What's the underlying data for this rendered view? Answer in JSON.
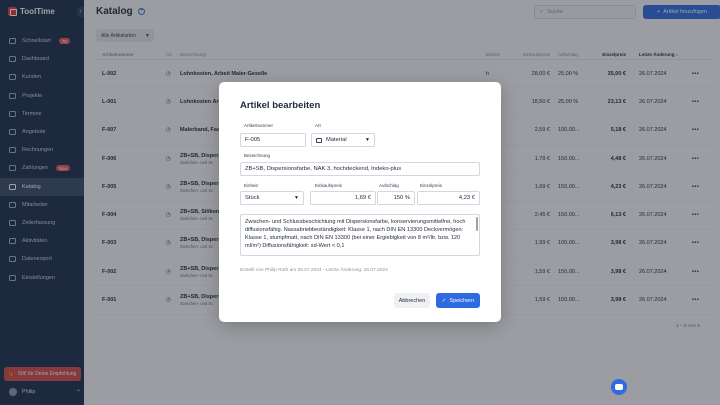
{
  "app": {
    "name": "ToolTime"
  },
  "sidebar": {
    "items": [
      {
        "label": "Schnellstart",
        "badge": "79",
        "icon": "rocket-icon"
      },
      {
        "label": "Dashboard",
        "icon": "dashboard-icon"
      },
      {
        "label": "Kunden",
        "icon": "users-icon"
      },
      {
        "label": "Projekte",
        "icon": "folder-icon"
      },
      {
        "label": "Termine",
        "icon": "calendar-icon"
      },
      {
        "label": "Angebote",
        "icon": "document-icon"
      },
      {
        "label": "Rechnungen",
        "icon": "invoice-icon"
      },
      {
        "label": "Zahlungen",
        "badge": "Neu",
        "icon": "payment-icon"
      },
      {
        "label": "Katalog",
        "active": true,
        "icon": "catalog-icon"
      },
      {
        "label": "Mitarbeiter",
        "icon": "team-icon"
      },
      {
        "label": "Zeiterfassung",
        "icon": "clock-icon"
      },
      {
        "label": "Aktivitäten",
        "icon": "activity-icon"
      },
      {
        "label": "Datenexport",
        "icon": "export-icon"
      },
      {
        "label": "Einstellungen",
        "icon": "gear-icon"
      }
    ],
    "promo": "50€ für Deine Empfehlung",
    "user": "Philip"
  },
  "main": {
    "title": "Katalog",
    "search_placeholder": "Suche",
    "add_button": "Artikel hinzufügen",
    "filter": "Alle Artikelarten",
    "columns": {
      "num": "Artikelnummer",
      "art": "Art",
      "desc": "Bezeichnung",
      "unit": "Einheit",
      "ek": "Einkaufspreis",
      "auf": "Aufschlag",
      "ep": "Einzelpreis",
      "date": "Letzte Änderung ↓"
    },
    "rows": [
      {
        "num": "L-002",
        "title": "Lohnkosten, Arbeit Maler-Geselle",
        "sub": "",
        "unit": "h",
        "ek": "28,00 €",
        "auf": "25,00 %",
        "ep": "35,00 €",
        "date": "26.07.2024"
      },
      {
        "num": "L-001",
        "title": "Lohnkosten Arb",
        "sub": "",
        "unit": "",
        "ek": "18,50 €",
        "auf": "25,00 %",
        "ep": "23,13 €",
        "date": "26.07.2024"
      },
      {
        "num": "F-007",
        "title": "Malerband, Fas",
        "sub": "",
        "unit": "",
        "ek": "2,59 €",
        "auf": "100,00...",
        "ep": "5,18 €",
        "date": "26.07.2024"
      },
      {
        "num": "F-006",
        "title": "ZB+SB, Dispers",
        "sub": "Zwischen- und Sc",
        "unit": "",
        "ek": "1,79 €",
        "auf": "150,00...",
        "ep": "4,48 €",
        "date": "26.07.2024"
      },
      {
        "num": "F-005",
        "title": "ZB+SB, Dispers",
        "sub": "Zwischen- und Sc",
        "unit": "",
        "ek": "1,69 €",
        "auf": "150,00...",
        "ep": "4,23 €",
        "date": "26.07.2024"
      },
      {
        "num": "F-004",
        "title": "ZB+SB, Silikon",
        "sub": "Zwischen- und Sc",
        "unit": "",
        "ek": "2,45 €",
        "auf": "150,00...",
        "ep": "6,13 €",
        "date": "26.07.2024"
      },
      {
        "num": "F-003",
        "title": "ZB+SB, Dispers",
        "sub": "Zwischen- und Sc",
        "unit": "",
        "ek": "1,99 €",
        "auf": "100,00...",
        "ep": "3,98 €",
        "date": "26.07.2024"
      },
      {
        "num": "F-002",
        "title": "ZB+SB, Dispers",
        "sub": "Zwischen- und Sc",
        "unit": "",
        "ek": "1,59 €",
        "auf": "150,00...",
        "ep": "3,98 €",
        "date": "26.07.2024"
      },
      {
        "num": "F-001",
        "title": "ZB+SB, Dispers",
        "sub": "Zwischen- und Sc",
        "unit": "",
        "ek": "1,59 €",
        "auf": "150,00...",
        "ep": "3,98 €",
        "date": "26.07.2024"
      }
    ],
    "pager": "1 – 9 von 9"
  },
  "modal": {
    "title": "Artikel bearbeiten",
    "fields": {
      "artikelnummer": {
        "label": "Artikelnummer",
        "value": "F-005"
      },
      "art": {
        "label": "Art",
        "value": "Material"
      },
      "bezeichnung": {
        "label": "Bezeichnung",
        "value": "ZB+SB, Dispersionsfarbe, NAK 3, hochdeckend, Indeko-plus"
      },
      "einheit": {
        "label": "Einheit",
        "value": "Stück"
      },
      "einkaufspreis": {
        "label": "Einkaufspreis",
        "value": "1,69 €"
      },
      "aufschlag": {
        "label": "Aufschlag",
        "value": "150 %"
      },
      "einzelpreis": {
        "label": "Einzelpreis",
        "value": "4,23 €"
      }
    },
    "description": "Zwischen- und Schlussbeschichtung mit Dispersionsfarbe, konservierungsmittelfrei, hoch diffusionsfähig. Nassabriebbeständigkeit: Klasse 1, nach DIN EN 13300 Deckvermögen: Klasse 1, stumpfmatt, nach DIN EN 13300 (bei einer Ergiebigkeit von 8 m²/ltr. bzw. 120 ml/m²) Diffusionsfähigkeit: sd-Wert < 0,1",
    "meta": "Erstellt von Philip Roth am 26.07.2024 - Letzte Änderung: 26.07.2024",
    "cancel": "Abbrechen",
    "save": "Speichern"
  }
}
